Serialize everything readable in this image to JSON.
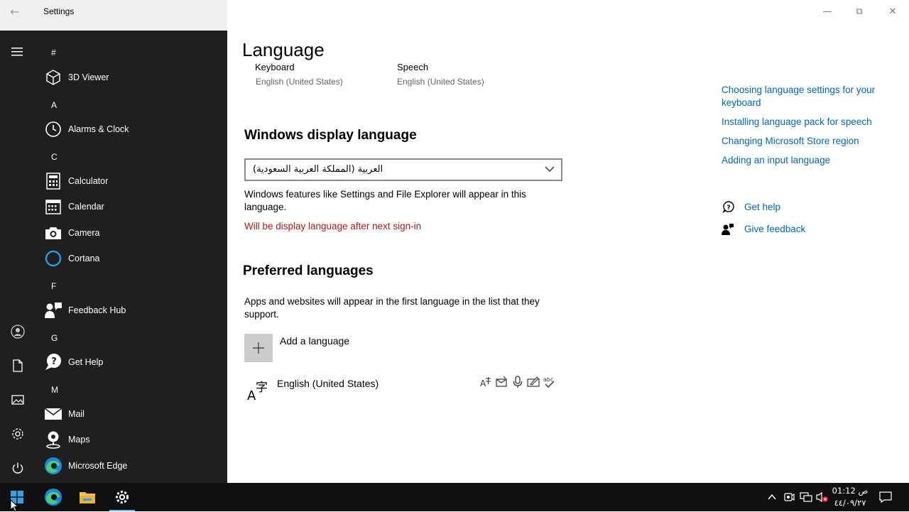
{
  "window": {
    "app_title": "Settings",
    "page_title": "Language"
  },
  "start_menu": {
    "rail_icons": [
      "hamburger-icon",
      "user-icon",
      "document-icon",
      "pictures-icon",
      "gear-icon",
      "power-icon"
    ],
    "groups": [
      {
        "letter": "#",
        "apps": [
          {
            "label": "3D Viewer",
            "icon": "cube-icon"
          }
        ]
      },
      {
        "letter": "A",
        "apps": [
          {
            "label": "Alarms & Clock",
            "icon": "clock-icon"
          }
        ]
      },
      {
        "letter": "C",
        "apps": [
          {
            "label": "Calculator",
            "icon": "calculator-icon"
          },
          {
            "label": "Calendar",
            "icon": "calendar-icon"
          },
          {
            "label": "Camera",
            "icon": "camera-icon"
          },
          {
            "label": "Cortana",
            "icon": "cortana-icon"
          }
        ]
      },
      {
        "letter": "F",
        "apps": [
          {
            "label": "Feedback Hub",
            "icon": "feedback-icon"
          }
        ]
      },
      {
        "letter": "G",
        "apps": [
          {
            "label": "Get Help",
            "icon": "help-icon"
          }
        ]
      },
      {
        "letter": "M",
        "apps": [
          {
            "label": "Mail",
            "icon": "mail-icon"
          },
          {
            "label": "Maps",
            "icon": "maps-icon"
          },
          {
            "label": "Microsoft Edge",
            "icon": "edge-icon"
          }
        ]
      }
    ]
  },
  "tiles": {
    "keyboard": {
      "label": "Keyboard",
      "value": "English (United States)"
    },
    "speech": {
      "label": "Speech",
      "value": "English (United States)"
    }
  },
  "display_language": {
    "title": "Windows display language",
    "selected": "العربية (المملكة العربية السعودية)",
    "description": "Windows features like Settings and File Explorer will appear in this language.",
    "notice": "Will be display language after next sign-in"
  },
  "preferred": {
    "title": "Preferred languages",
    "description": "Apps and websites will appear in the first language in the list that they support.",
    "add_label": "Add a language",
    "languages": [
      {
        "name": "English (United States)",
        "features": [
          "language-pack-icon",
          "text-to-speech-icon",
          "speech-recognition-icon",
          "handwriting-icon",
          "spell-check-icon"
        ]
      }
    ]
  },
  "related": {
    "links": [
      "Choosing language settings for your keyboard",
      "Installing language pack for speech",
      "Changing Microsoft Store region",
      "Adding an input language"
    ],
    "get_help": "Get help",
    "give_feedback": "Give feedback"
  },
  "taskbar": {
    "apps": [
      "start-icon",
      "edge-icon",
      "file-explorer-icon",
      "settings-icon"
    ],
    "clock_time": "01:12 ص",
    "clock_date": "٤٤/٠٩/٢٧"
  },
  "colors": {
    "link": "#0067b8",
    "warning": "#b51818",
    "start_bg": "#1f1f1f",
    "taskbar_bg": "#101010"
  }
}
